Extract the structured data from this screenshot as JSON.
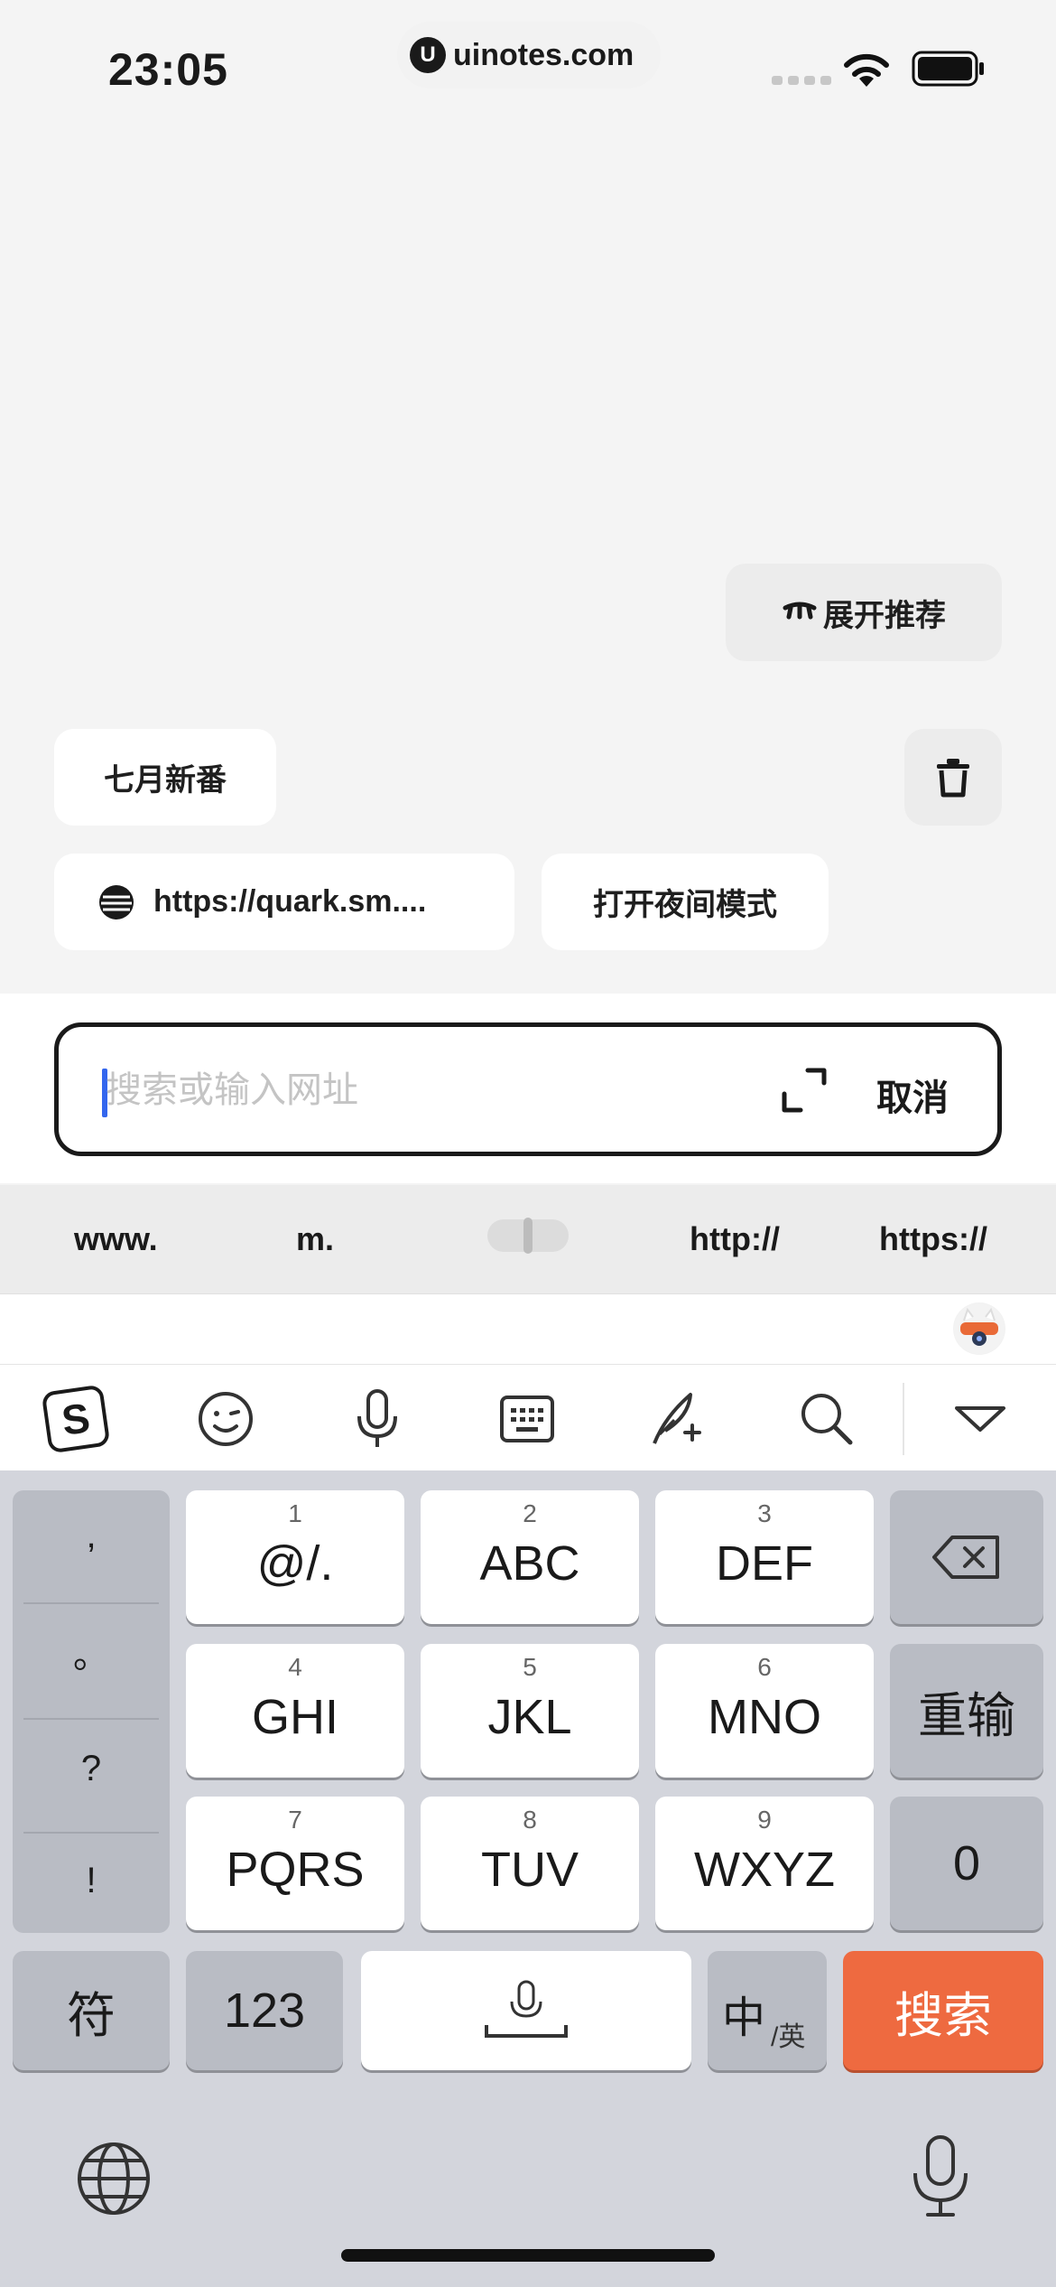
{
  "status_bar": {
    "time": "23:05",
    "domain": "uinotes.com",
    "logo_letter": "U"
  },
  "top": {
    "expand_label": "展开推荐"
  },
  "history": {
    "chip1": "七月新番",
    "url_chip": "https://quark.sm....",
    "night_chip": "打开夜间模式"
  },
  "search": {
    "placeholder": "搜索或输入网址",
    "cancel": "取消"
  },
  "shortcuts": {
    "www": "www.",
    "m": "m.",
    "http": "http://",
    "https": "https://"
  },
  "keyboard": {
    "punct": [
      ",",
      "。",
      "?",
      "!"
    ],
    "keys": [
      {
        "num": "1",
        "label": "@/."
      },
      {
        "num": "2",
        "label": "ABC"
      },
      {
        "num": "3",
        "label": "DEF"
      },
      {
        "num": "4",
        "label": "GHI"
      },
      {
        "num": "5",
        "label": "JKL"
      },
      {
        "num": "6",
        "label": "MNO"
      },
      {
        "num": "7",
        "label": "PQRS"
      },
      {
        "num": "8",
        "label": "TUV"
      },
      {
        "num": "9",
        "label": "WXYZ"
      }
    ],
    "reset": "重输",
    "zero": "0",
    "symbol": "符",
    "num_mode": "123",
    "lang_main": "中",
    "lang_sub": "/英",
    "search": "搜索"
  },
  "colors": {
    "accent": "#ee6a40",
    "caret": "#3366ee"
  }
}
